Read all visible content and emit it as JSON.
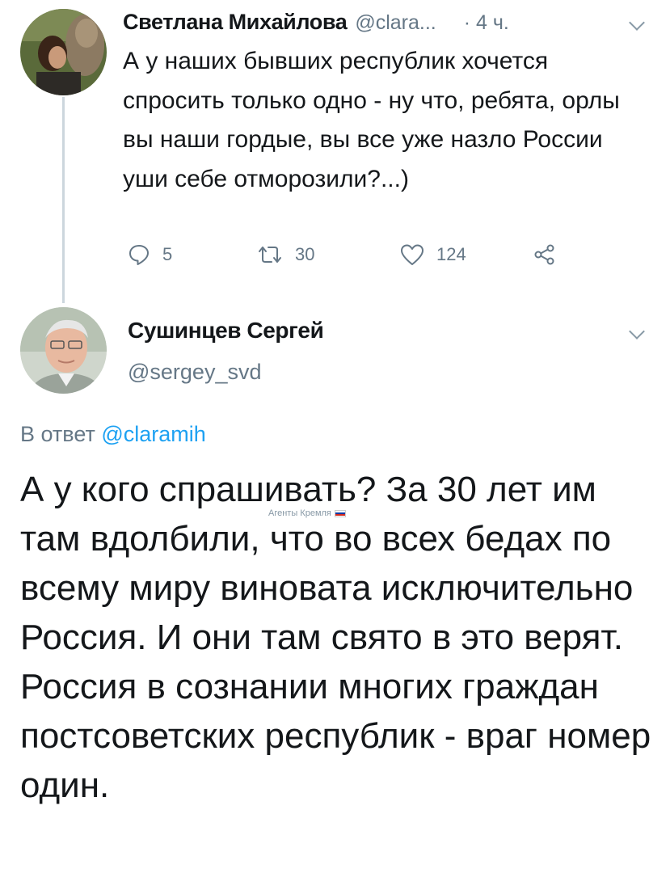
{
  "tweet1": {
    "author_name": "Светлана Михайлова",
    "handle": "@clara...",
    "time": "· 4 ч.",
    "text": "А у наших бывших республик хочется спросить только одно - ну что, ребята, орлы вы наши гордые, вы все уже назло России уши себе отморозили?...)",
    "actions": {
      "replies": "5",
      "retweets": "30",
      "likes": "124"
    }
  },
  "tweet2": {
    "author_name": "Сушинцев Сергей",
    "handle": "@sergey_svd",
    "reply_prefix": "В ответ",
    "reply_mention": "@claramih",
    "text": "А у кого спрашивать? За 30 лет им там вдолбили, что во всех бедах по всему миру виновата исключительно Россия. И они там свято в это верят. Россия в сознании многих граждан постсоветских республик - враг номер один."
  },
  "watermark": {
    "text": "Агенты Кремля"
  },
  "icons": {
    "reply": "reply-icon",
    "retweet": "retweet-icon",
    "like": "like-icon",
    "share": "share-icon",
    "more": "chevron-down-icon"
  },
  "colors": {
    "text": "#14171a",
    "secondary": "#657786",
    "link": "#1da1f2",
    "thread_line": "#ccd6dd"
  }
}
